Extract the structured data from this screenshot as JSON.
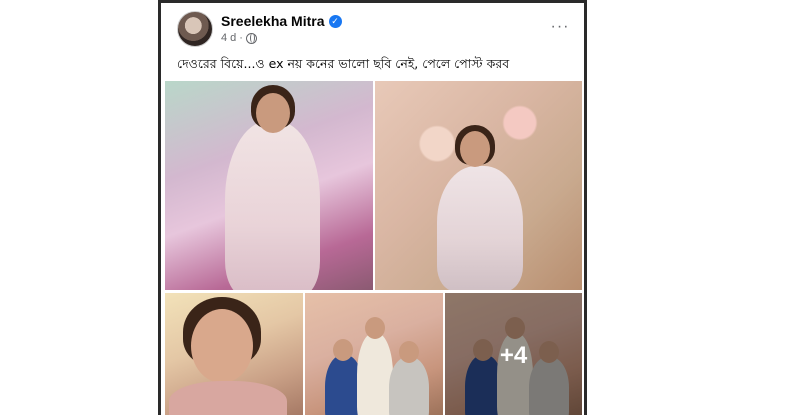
{
  "post": {
    "author": "Sreelekha Mitra",
    "time": "4 d",
    "text": "দেওরের বিয়ে...ও ex নয় কনের ভালো ছবি নেই, পেলে পোস্ট করব",
    "more_menu": "···"
  },
  "photos": {
    "more_count": "+4"
  },
  "colors": {
    "verified": "#1877f2",
    "meta_text": "#65676b",
    "card_border": "#2a2a2a"
  },
  "icons": [
    "verified-badge-icon",
    "globe-icon",
    "more-options-icon"
  ]
}
